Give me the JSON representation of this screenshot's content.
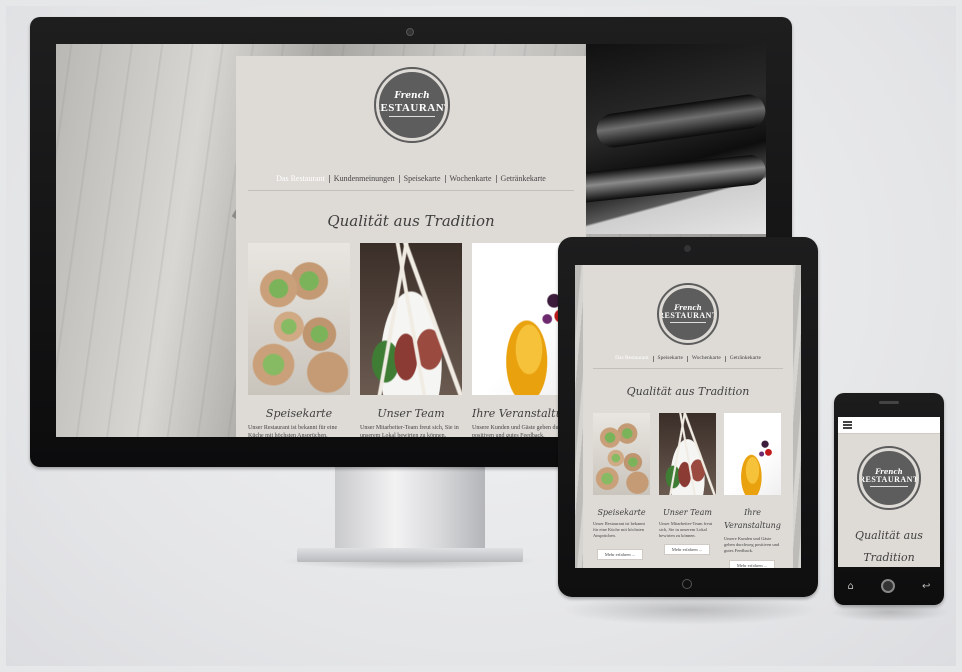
{
  "logo": {
    "line1": "French",
    "line2": "RESTAURANT"
  },
  "nav": [
    "Das Restaurant",
    "Kundenmeinungen",
    "Speisekarte",
    "Wochenkarte",
    "Getränkekarte"
  ],
  "nav_tablet": [
    "Das Restaurant",
    "Speisekarte",
    "Wochenkarte",
    "Getränkekarte"
  ],
  "headline": "Qualität aus Tradition",
  "cards": [
    {
      "title": "Speisekarte",
      "text": "Unser Restaurant ist bekannt für eine Küche mit höchsten Ansprüchen."
    },
    {
      "title": "Unser Team",
      "text": "Unser Mitarbeiter-Team freut sich, Sie in unserem Lokal bewirten zu können."
    },
    {
      "title": "Ihre Veranstaltung",
      "title_cut": "Ihre Veranstaltu",
      "text": "Unsere Kunden und Gäste geben durchweg positiven und gutes Feedback."
    }
  ],
  "tablet_cards": [
    {
      "title": "Speisekarte",
      "text": "Unser Restaurant ist bekannt für eine Küche mit höchsten Ansprüchen.",
      "button": "Mehr erfahren ..."
    },
    {
      "title": "Unser Team",
      "text": "Unser Mitarbeiter-Team freut sich, Sie in unserem Lokal bewirten zu können.",
      "button": "Mehr erfahren ..."
    },
    {
      "title_l1": "Ihre",
      "title_l2": "Veranstaltung",
      "text": "Unsere Kunden und Gäste geben durchweg positiven und gutes Feedback.",
      "button": "Mehr erfahren ..."
    }
  ],
  "phone": {
    "headline_l1": "Qualität aus",
    "headline_l2": "Tradition",
    "keys": [
      "⌂",
      "↩"
    ]
  },
  "colors": {
    "panel": "#dedbd7",
    "logo": "#5d5d5d",
    "bezel": "#111111"
  }
}
